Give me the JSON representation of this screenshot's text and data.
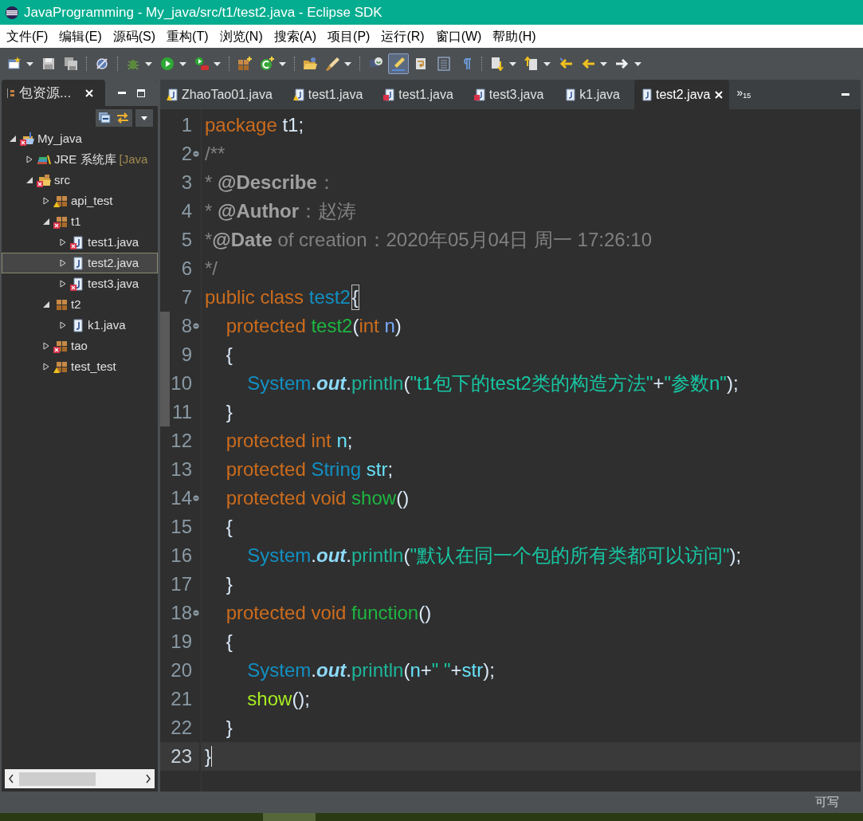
{
  "window": {
    "title": "JavaProgramming - My_java/src/t1/test2.java - Eclipse SDK"
  },
  "menu": [
    "文件(F)",
    "编辑(E)",
    "源码(S)",
    "重构(T)",
    "浏览(N)",
    "搜索(A)",
    "项目(P)",
    "运行(R)",
    "窗口(W)",
    "帮助(H)"
  ],
  "toolbar": [
    {
      "kind": "new",
      "dropdown": true,
      "pressed": false
    },
    {
      "kind": "save",
      "dropdown": false,
      "pressed": false
    },
    {
      "kind": "saveall",
      "dropdown": false,
      "pressed": false
    },
    {
      "kind": "sep"
    },
    {
      "kind": "skip",
      "dropdown": false,
      "pressed": false
    },
    {
      "kind": "sep"
    },
    {
      "kind": "debug",
      "dropdown": true,
      "pressed": false
    },
    {
      "kind": "run",
      "dropdown": true,
      "pressed": false
    },
    {
      "kind": "external",
      "dropdown": true,
      "pressed": false
    },
    {
      "kind": "sep"
    },
    {
      "kind": "package",
      "dropdown": false,
      "pressed": false
    },
    {
      "kind": "newclass",
      "dropdown": true,
      "pressed": false
    },
    {
      "kind": "sep"
    },
    {
      "kind": "folder",
      "dropdown": false,
      "pressed": false
    },
    {
      "kind": "brush",
      "dropdown": true,
      "pressed": false
    },
    {
      "kind": "sep"
    },
    {
      "kind": "task",
      "dropdown": false,
      "pressed": false
    },
    {
      "kind": "highlight",
      "dropdown": false,
      "pressed": true
    },
    {
      "kind": "wordwrap",
      "dropdown": false,
      "pressed": false
    },
    {
      "kind": "block",
      "dropdown": false,
      "pressed": false
    },
    {
      "kind": "pilcrow",
      "dropdown": false,
      "pressed": false
    },
    {
      "kind": "sep"
    },
    {
      "kind": "nextann",
      "dropdown": true,
      "pressed": false
    },
    {
      "kind": "prevann",
      "dropdown": true,
      "pressed": false
    },
    {
      "kind": "lastedit",
      "dropdown": false,
      "pressed": false
    },
    {
      "kind": "back",
      "dropdown": true,
      "pressed": false
    },
    {
      "kind": "forward",
      "dropdown": true,
      "pressed": false
    }
  ],
  "explorer": {
    "title": "包资源...",
    "tree": [
      {
        "label": "My_java",
        "kind": "project",
        "error": true,
        "warning": false,
        "expanded": true,
        "selected": false,
        "children": [
          {
            "label": "JRE 系统库",
            "suffix": "[Java",
            "kind": "library",
            "error": false,
            "warning": false,
            "expanded": false,
            "selected": false
          },
          {
            "label": "src",
            "kind": "srcfolder",
            "error": true,
            "warning": false,
            "expanded": true,
            "selected": false,
            "children": [
              {
                "label": "api_test",
                "kind": "package",
                "error": false,
                "warning": true,
                "expanded": false,
                "selected": false
              },
              {
                "label": "t1",
                "kind": "package",
                "error": true,
                "warning": false,
                "expanded": true,
                "selected": false,
                "children": [
                  {
                    "label": "test1.java",
                    "kind": "file",
                    "error": true,
                    "warning": false,
                    "expanded": false,
                    "selected": false
                  },
                  {
                    "label": "test2.java",
                    "kind": "file",
                    "error": false,
                    "warning": false,
                    "expanded": false,
                    "selected": true
                  },
                  {
                    "label": "test3.java",
                    "kind": "file",
                    "error": true,
                    "warning": false,
                    "expanded": false,
                    "selected": false
                  }
                ]
              },
              {
                "label": "t2",
                "kind": "package",
                "error": false,
                "warning": false,
                "expanded": true,
                "selected": false,
                "children": [
                  {
                    "label": "k1.java",
                    "kind": "file",
                    "error": false,
                    "warning": false,
                    "expanded": false,
                    "selected": false
                  }
                ]
              },
              {
                "label": "tao",
                "kind": "package",
                "error": true,
                "warning": false,
                "expanded": false,
                "selected": false
              },
              {
                "label": "test_test",
                "kind": "package",
                "error": false,
                "warning": true,
                "expanded": false,
                "selected": false
              }
            ]
          }
        ]
      }
    ]
  },
  "editor_tabs": [
    {
      "label": "ZhaoTao01.java",
      "error": false,
      "warning": true,
      "selected": false
    },
    {
      "label": "test1.java",
      "error": false,
      "warning": true,
      "selected": false
    },
    {
      "label": "test1.java",
      "error": true,
      "warning": false,
      "selected": false
    },
    {
      "label": "test3.java",
      "error": true,
      "warning": false,
      "selected": false
    },
    {
      "label": "k1.java",
      "error": false,
      "warning": false,
      "selected": false
    },
    {
      "label": "test2.java",
      "error": false,
      "warning": false,
      "selected": true
    }
  ],
  "overflow": {
    "glyph": "»",
    "count": "15"
  },
  "code": [
    {
      "number": "1",
      "fold": false,
      "range": false,
      "current": false,
      "tokens": [
        {
          "kind": "kw",
          "t": "package"
        },
        {
          "kind": "plain",
          "t": " t1;"
        }
      ]
    },
    {
      "number": "2",
      "fold": true,
      "range": false,
      "current": false,
      "tokens": [
        {
          "kind": "comment",
          "t": "/**"
        }
      ]
    },
    {
      "number": "3",
      "fold": false,
      "range": false,
      "current": false,
      "tokens": [
        {
          "kind": "comment",
          "t": "* "
        },
        {
          "kind": "tag",
          "t": "@Describe"
        },
        {
          "kind": "comment",
          "t": "："
        }
      ]
    },
    {
      "number": "4",
      "fold": false,
      "range": false,
      "current": false,
      "tokens": [
        {
          "kind": "comment",
          "t": "* "
        },
        {
          "kind": "tag",
          "t": "@Author"
        },
        {
          "kind": "comment",
          "t": "：赵涛"
        }
      ]
    },
    {
      "number": "5",
      "fold": false,
      "range": false,
      "current": false,
      "tokens": [
        {
          "kind": "comment",
          "t": "*"
        },
        {
          "kind": "tag",
          "t": "@Date"
        },
        {
          "kind": "comment",
          "t": " of creation：2020年05月04日 周一 17:26:10"
        }
      ]
    },
    {
      "number": "6",
      "fold": false,
      "range": false,
      "current": false,
      "tokens": [
        {
          "kind": "comment",
          "t": "*/"
        }
      ]
    },
    {
      "number": "7",
      "fold": false,
      "range": false,
      "current": false,
      "tokens": [
        {
          "kind": "kw",
          "t": "public class "
        },
        {
          "kind": "type",
          "t": "test2"
        },
        {
          "kind": "matched",
          "t": "{"
        }
      ]
    },
    {
      "number": "8",
      "fold": true,
      "range": true,
      "current": false,
      "tokens": [
        {
          "kind": "kw",
          "t": "    protected "
        },
        {
          "kind": "decl",
          "t": "test2"
        },
        {
          "kind": "plain",
          "t": "("
        },
        {
          "kind": "kw",
          "t": "int "
        },
        {
          "kind": "param",
          "t": "n"
        },
        {
          "kind": "plain",
          "t": ")"
        }
      ]
    },
    {
      "number": "9",
      "fold": false,
      "range": true,
      "current": false,
      "tokens": [
        {
          "kind": "plain",
          "t": "    {"
        }
      ]
    },
    {
      "number": "10",
      "fold": false,
      "range": true,
      "current": false,
      "tokens": [
        {
          "kind": "type",
          "t": "        System"
        },
        {
          "kind": "plain",
          "t": "."
        },
        {
          "kind": "static",
          "t": "out"
        },
        {
          "kind": "plain",
          "t": "."
        },
        {
          "kind": "method",
          "t": "println"
        },
        {
          "kind": "plain",
          "t": "("
        },
        {
          "kind": "str",
          "t": "\"t1包下的test2类的构造方法\""
        },
        {
          "kind": "plain",
          "t": "+"
        },
        {
          "kind": "str",
          "t": "\"参数n\""
        },
        {
          "kind": "plain",
          "t": ");"
        }
      ]
    },
    {
      "number": "11",
      "fold": false,
      "range": true,
      "current": false,
      "tokens": [
        {
          "kind": "plain",
          "t": "    }"
        }
      ]
    },
    {
      "number": "12",
      "fold": false,
      "range": false,
      "current": false,
      "tokens": [
        {
          "kind": "kw",
          "t": "    protected int "
        },
        {
          "kind": "field",
          "t": "n"
        },
        {
          "kind": "plain",
          "t": ";"
        }
      ]
    },
    {
      "number": "13",
      "fold": false,
      "range": false,
      "current": false,
      "tokens": [
        {
          "kind": "kw",
          "t": "    protected "
        },
        {
          "kind": "type",
          "t": "String "
        },
        {
          "kind": "field",
          "t": "str"
        },
        {
          "kind": "plain",
          "t": ";"
        }
      ]
    },
    {
      "number": "14",
      "fold": true,
      "range": false,
      "current": false,
      "tokens": [
        {
          "kind": "kw",
          "t": "    protected void "
        },
        {
          "kind": "decl",
          "t": "show"
        },
        {
          "kind": "plain",
          "t": "()"
        }
      ]
    },
    {
      "number": "15",
      "fold": false,
      "range": false,
      "current": false,
      "tokens": [
        {
          "kind": "plain",
          "t": "    {"
        }
      ]
    },
    {
      "number": "16",
      "fold": false,
      "range": false,
      "current": false,
      "tokens": [
        {
          "kind": "type",
          "t": "        System"
        },
        {
          "kind": "plain",
          "t": "."
        },
        {
          "kind": "static",
          "t": "out"
        },
        {
          "kind": "plain",
          "t": "."
        },
        {
          "kind": "method",
          "t": "println"
        },
        {
          "kind": "plain",
          "t": "("
        },
        {
          "kind": "str",
          "t": "\"默认在同一个包的所有类都可以访问\""
        },
        {
          "kind": "plain",
          "t": ");"
        }
      ]
    },
    {
      "number": "17",
      "fold": false,
      "range": false,
      "current": false,
      "tokens": [
        {
          "kind": "plain",
          "t": "    }"
        }
      ]
    },
    {
      "number": "18",
      "fold": true,
      "range": false,
      "current": false,
      "tokens": [
        {
          "kind": "kw",
          "t": "    protected void "
        },
        {
          "kind": "decl",
          "t": "function"
        },
        {
          "kind": "plain",
          "t": "()"
        }
      ]
    },
    {
      "number": "19",
      "fold": false,
      "range": false,
      "current": false,
      "tokens": [
        {
          "kind": "plain",
          "t": "    {"
        }
      ]
    },
    {
      "number": "20",
      "fold": false,
      "range": false,
      "current": false,
      "tokens": [
        {
          "kind": "type",
          "t": "        System"
        },
        {
          "kind": "plain",
          "t": "."
        },
        {
          "kind": "static",
          "t": "out"
        },
        {
          "kind": "plain",
          "t": "."
        },
        {
          "kind": "method",
          "t": "println"
        },
        {
          "kind": "plain",
          "t": "("
        },
        {
          "kind": "field",
          "t": "n"
        },
        {
          "kind": "plain",
          "t": "+"
        },
        {
          "kind": "str",
          "t": "\" \""
        },
        {
          "kind": "plain",
          "t": "+"
        },
        {
          "kind": "field",
          "t": "str"
        },
        {
          "kind": "plain",
          "t": ");"
        }
      ]
    },
    {
      "number": "21",
      "fold": false,
      "range": false,
      "current": false,
      "tokens": [
        {
          "kind": "call",
          "t": "        show"
        },
        {
          "kind": "plain",
          "t": "();"
        }
      ]
    },
    {
      "number": "22",
      "fold": false,
      "range": false,
      "current": false,
      "tokens": [
        {
          "kind": "plain",
          "t": "    }"
        }
      ]
    },
    {
      "number": "23",
      "fold": false,
      "range": false,
      "current": true,
      "tokens": [
        {
          "kind": "plain",
          "t": "}"
        }
      ]
    }
  ],
  "status_bar": {
    "mode": "可写"
  }
}
